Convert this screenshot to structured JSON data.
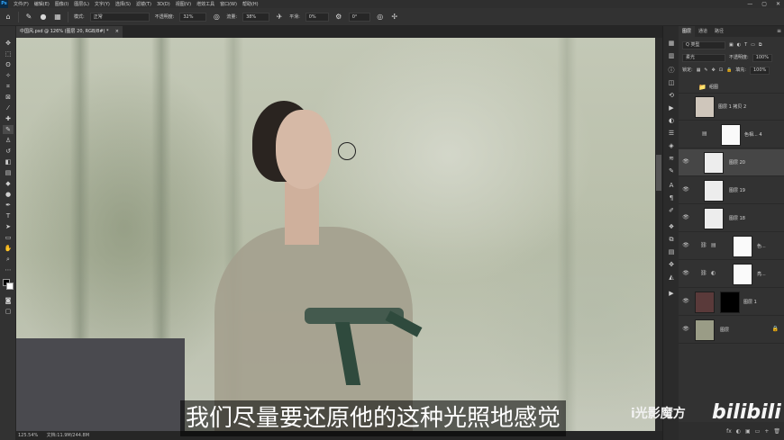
{
  "app": {
    "logo": "Ps",
    "menu": [
      "文件(F)",
      "编辑(E)",
      "图像(I)",
      "图层(L)",
      "文字(Y)",
      "选择(S)",
      "滤镜(T)",
      "3D(D)",
      "视图(V)",
      "增效工具",
      "窗口(W)",
      "帮助(H)"
    ],
    "window_controls": {
      "minimize": "—",
      "maximize": "▢",
      "close": "✕"
    }
  },
  "options": {
    "mode_label": "模式:",
    "mode_value": "正常",
    "opacity_label": "不透明度:",
    "opacity_value": "32%",
    "flow_label": "流量:",
    "flow_value": "38%",
    "smooth_label": "平滑:",
    "smooth_value": "0%",
    "angle_value": "0°"
  },
  "document": {
    "tab_title": "中国风.psd @ 126% (图层 20, RGB/8#) *",
    "close": "×"
  },
  "status": {
    "zoom": "125.54%",
    "doc_size": "文档:11.9M/244.8M"
  },
  "subtitle": "我们尽量要还原他的这种光照地感觉",
  "watermark": {
    "channel": "i光影魔方",
    "site": "bilibili"
  },
  "layers_panel": {
    "tabs": [
      "图层",
      "通道",
      "路径"
    ],
    "kind_filter": "Q 类型",
    "blend_mode": "柔光",
    "opacity_label": "不透明度:",
    "opacity_value": "100%",
    "lock_label": "锁定:",
    "fill_label": "填充:",
    "fill_value": "100%",
    "group_name": "组图",
    "layers": [
      {
        "name": "图层 1 拷贝 2"
      },
      {
        "name": "色相... 4"
      },
      {
        "name": "图层 20"
      },
      {
        "name": "图层 19"
      },
      {
        "name": "图层 18"
      },
      {
        "name": "色..."
      },
      {
        "name": "亮..."
      },
      {
        "name": "图层 1"
      },
      {
        "name": "图层"
      }
    ],
    "footer_icons": [
      "fx",
      "◐",
      "▣",
      "▭",
      "+",
      "🗑"
    ]
  },
  "icons": {
    "visibility": "👁",
    "link": "⛓",
    "lock": "🔒",
    "folder": "📁",
    "menu": "≡"
  }
}
